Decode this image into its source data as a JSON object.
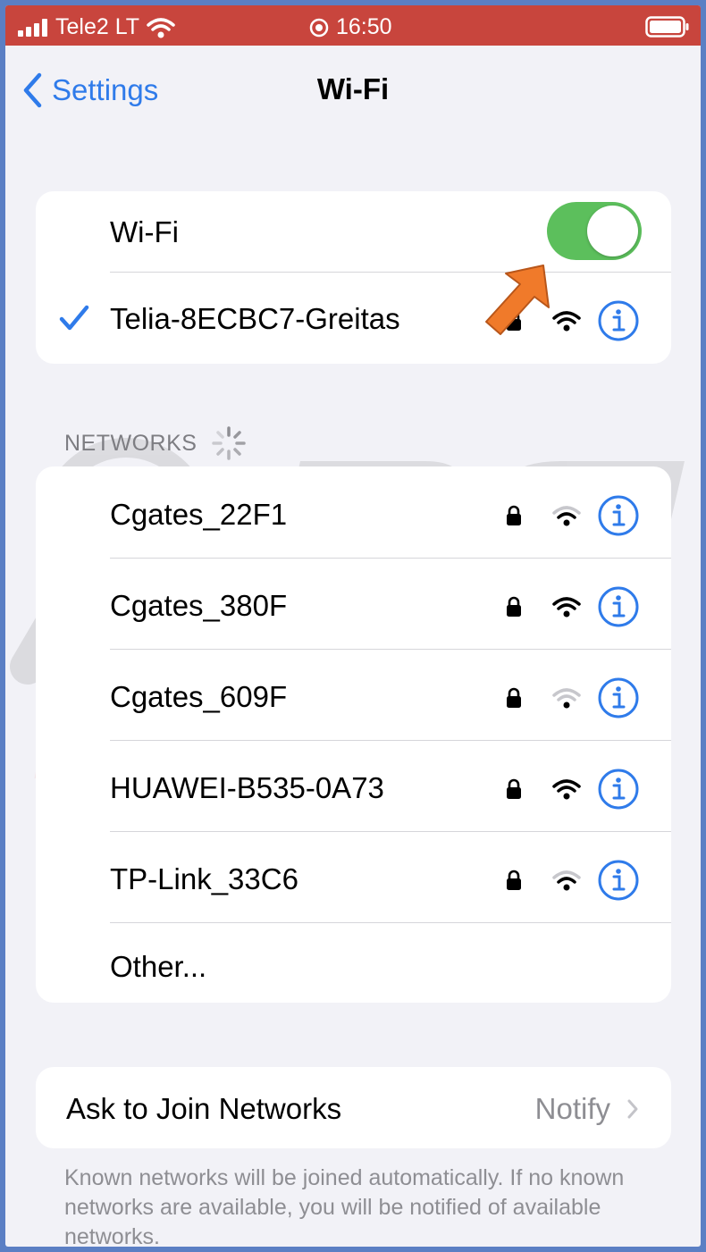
{
  "status_bar": {
    "carrier": "Tele2 LT",
    "time": "16:50"
  },
  "nav": {
    "back_label": "Settings",
    "title": "Wi-Fi"
  },
  "wifi_card": {
    "toggle_label": "Wi-Fi",
    "toggle_on": true,
    "connected_network": "Telia-8ECBC7-Greitas"
  },
  "networks": {
    "header": "NETWORKS",
    "items": [
      {
        "name": "Cgates_22F1",
        "secured": true,
        "signal": "medium"
      },
      {
        "name": "Cgates_380F",
        "secured": true,
        "signal": "full"
      },
      {
        "name": "Cgates_609F",
        "secured": true,
        "signal": "low"
      },
      {
        "name": "HUAWEI-B535-0A73",
        "secured": true,
        "signal": "full"
      },
      {
        "name": "TP-Link_33C6",
        "secured": true,
        "signal": "medium"
      }
    ],
    "other_label": "Other..."
  },
  "ask_to_join": {
    "label": "Ask to Join Networks",
    "value": "Notify"
  },
  "footnote": "Known networks will be joined automatically. If no known networks are available, you will be notified of available networks.",
  "colors": {
    "accent": "#2f7bea",
    "toggle_on": "#5cbf5c",
    "status_bar": "#c8453d",
    "arrow": "#f07a2a"
  }
}
